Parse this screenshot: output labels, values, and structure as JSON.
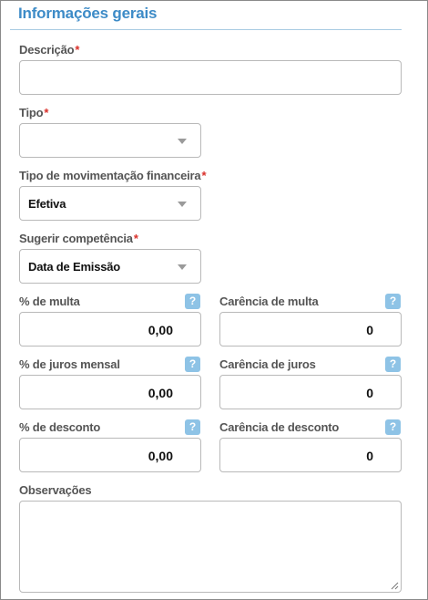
{
  "section": {
    "title": "Informações gerais"
  },
  "fields": {
    "descricao": {
      "label": "Descrição",
      "required_mark": "*",
      "value": ""
    },
    "tipo": {
      "label": "Tipo",
      "required_mark": "*",
      "value": ""
    },
    "tipo_movimentacao": {
      "label": "Tipo de movimentação financeira",
      "required_mark": "*",
      "value": "Efetiva"
    },
    "sugerir_competencia": {
      "label": "Sugerir competência",
      "required_mark": "*",
      "value": "Data de Emissão"
    },
    "multa": {
      "label": "% de multa",
      "value": "0,00"
    },
    "carencia_multa": {
      "label": "Carência de multa",
      "value": "0"
    },
    "juros": {
      "label": "% de juros mensal",
      "value": "0,00"
    },
    "carencia_juros": {
      "label": "Carência de juros",
      "value": "0"
    },
    "desconto": {
      "label": "% de desconto",
      "value": "0,00"
    },
    "carencia_desconto": {
      "label": "Carência de desconto",
      "value": "0"
    },
    "observacoes": {
      "label": "Observações",
      "value": ""
    }
  },
  "help_glyph": "?",
  "colors": {
    "accent": "#3d8bc7",
    "required": "#d9302a",
    "help_bg": "#8ec3e6",
    "border": "#b9b9b9"
  }
}
